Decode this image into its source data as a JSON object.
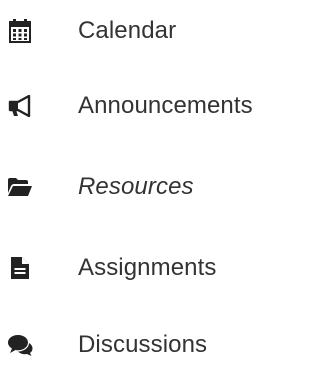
{
  "nav": {
    "items": [
      {
        "label": "Calendar",
        "icon": "calendar-icon"
      },
      {
        "label": "Announcements",
        "icon": "megaphone-icon"
      },
      {
        "label": "Resources",
        "icon": "folder-open-icon",
        "style": "italic"
      },
      {
        "label": "Assignments",
        "icon": "file-text-icon"
      },
      {
        "label": "Discussions",
        "icon": "comments-icon"
      }
    ]
  },
  "colors": {
    "icon": "#222222",
    "text": "#333333"
  }
}
